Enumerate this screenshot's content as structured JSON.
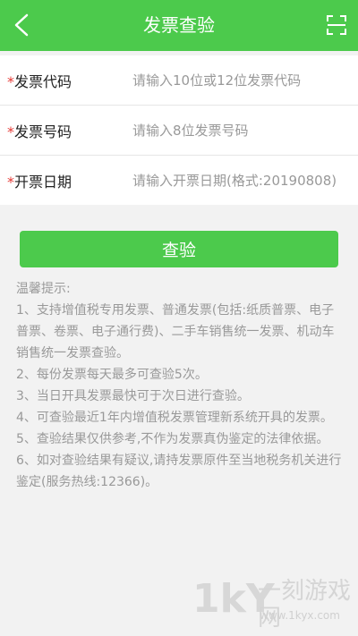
{
  "header": {
    "title": "发票查验",
    "back_icon": "chevron-left-icon",
    "scan_icon": "scan-icon"
  },
  "form": {
    "required_mark": "*",
    "fields": [
      {
        "label": "发票代码",
        "placeholder": "请输入10位或12位发票代码",
        "value": ""
      },
      {
        "label": "发票号码",
        "placeholder": "请输入8位发票号码",
        "value": ""
      },
      {
        "label": "开票日期",
        "placeholder": "请输入开票日期(格式:20190808)",
        "value": ""
      }
    ]
  },
  "submit_label": "查验",
  "tips": {
    "title": "温馨提示:",
    "items": [
      "1、支持增值税专用发票、普通发票(包括:纸质普票、电子普票、卷票、电子通行费)、二手车销售统一发票、机动车销售统一发票查验。",
      "2、每份发票每天最多可查验5次。",
      "3、当日开具发票最快可于次日进行查验。",
      "4、可查验最近1年内增值税发票管理新系统开具的发票。",
      "5、查验结果仅供参考,不作为发票真伪鉴定的法律依据。",
      "6、如对查验结果有疑议,请持发票原件至当地税务机关进行鉴定(服务热线:12366)。"
    ]
  },
  "watermark": {
    "logo": "1kY",
    "text": "一刻游戏网",
    "url": "www.1kyx.com"
  },
  "colors": {
    "primary": "#4cca4c",
    "required": "#e53935",
    "tip_text": "#999999"
  }
}
